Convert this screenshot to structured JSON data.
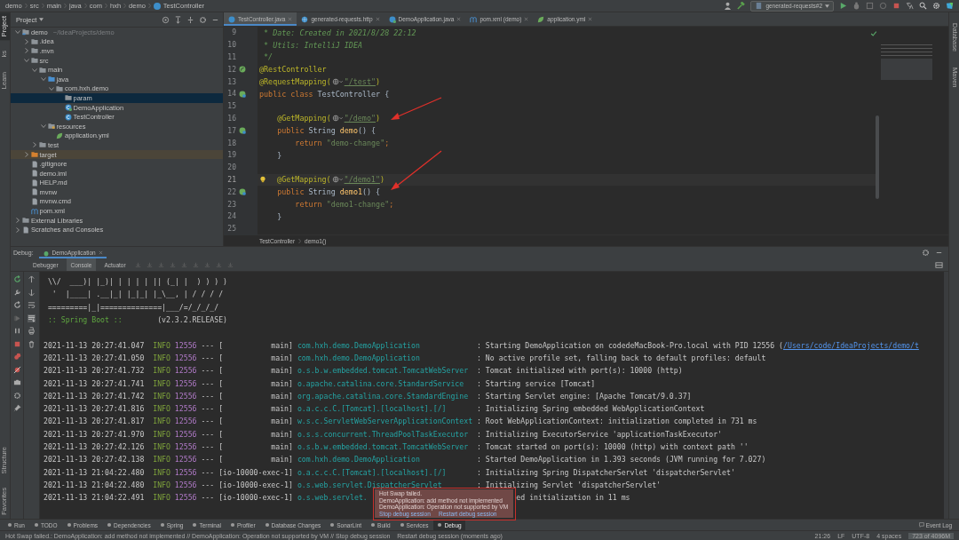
{
  "breadcrumb": [
    "demo",
    "src",
    "main",
    "java",
    "com",
    "hxh",
    "demo",
    "TestController"
  ],
  "run_config": "generated-requests#2",
  "left_strip": {
    "top": [
      {
        "label": "Project",
        "selected": true
      },
      {
        "label": "ks",
        "selected": false
      },
      {
        "label": "Learn",
        "selected": false
      }
    ],
    "bottom": [
      {
        "label": "Structure",
        "selected": false
      },
      {
        "label": "Favorites",
        "selected": false
      }
    ]
  },
  "right_strip": [
    "Database",
    "Maven"
  ],
  "project_panel": {
    "title": "Project",
    "tree": [
      {
        "label": "demo",
        "hint": "~/IdeaProjects/demo",
        "kind": "module",
        "expanded": true,
        "selected": false,
        "children": [
          {
            "label": ".idea",
            "kind": "folder",
            "expanded": false,
            "selected": false
          },
          {
            "label": ".mvn",
            "kind": "folder",
            "expanded": false,
            "selected": false
          },
          {
            "label": "src",
            "kind": "folder",
            "expanded": true,
            "selected": false,
            "children": [
              {
                "label": "main",
                "kind": "folder",
                "expanded": true,
                "selected": false,
                "children": [
                  {
                    "label": "java",
                    "kind": "source-folder",
                    "expanded": true,
                    "selected": false,
                    "children": [
                      {
                        "label": "com.hxh.demo",
                        "kind": "package",
                        "expanded": true,
                        "selected": false,
                        "children": [
                          {
                            "label": "param",
                            "kind": "package",
                            "selected": true
                          },
                          {
                            "label": "DemoApplication",
                            "kind": "app-class",
                            "selected": false
                          },
                          {
                            "label": "TestController",
                            "kind": "class",
                            "selected": false
                          }
                        ]
                      }
                    ]
                  },
                  {
                    "label": "resources",
                    "kind": "resource-folder",
                    "expanded": true,
                    "selected": false,
                    "children": [
                      {
                        "label": "application.yml",
                        "kind": "yml",
                        "selected": false
                      }
                    ]
                  }
                ]
              },
              {
                "label": "test",
                "kind": "folder",
                "expanded": false,
                "selected": false
              }
            ]
          },
          {
            "label": "target",
            "kind": "excluded-folder",
            "expanded": false,
            "selected": false
          },
          {
            "label": ".gitignore",
            "kind": "file",
            "selected": false
          },
          {
            "label": "demo.iml",
            "kind": "file",
            "selected": false
          },
          {
            "label": "HELP.md",
            "kind": "file",
            "selected": false
          },
          {
            "label": "mvnw",
            "kind": "file",
            "selected": false
          },
          {
            "label": "mvnw.cmd",
            "kind": "file",
            "selected": false
          },
          {
            "label": "pom.xml",
            "kind": "maven",
            "selected": false
          }
        ]
      },
      {
        "label": "External Libraries",
        "kind": "library",
        "expanded": false,
        "selected": false
      },
      {
        "label": "Scratches and Consoles",
        "kind": "scratches",
        "expanded": false,
        "selected": false
      }
    ]
  },
  "editor": {
    "tabs": [
      {
        "label": "TestController.java",
        "kind": "class",
        "selected": true
      },
      {
        "label": "generated-requests.http",
        "kind": "http",
        "selected": false
      },
      {
        "label": "DemoApplication.java",
        "kind": "app-class",
        "selected": false
      },
      {
        "label": "pom.xml (demo)",
        "kind": "maven",
        "selected": false
      },
      {
        "label": "application.yml",
        "kind": "yml",
        "selected": false
      }
    ],
    "lines": [
      {
        "number": "9",
        "current": false,
        "kind": "plain",
        "tokens": [
          {
            "kind": "comment",
            "text": " * Date: Created in 2021/8/28 22:12"
          }
        ]
      },
      {
        "number": "10",
        "current": false,
        "kind": "plain",
        "tokens": [
          {
            "kind": "comment",
            "text": " * Utils: IntelliJ IDEA"
          }
        ]
      },
      {
        "number": "11",
        "current": false,
        "kind": "plain",
        "tokens": [
          {
            "kind": "comment",
            "text": " */"
          }
        ]
      },
      {
        "number": "12",
        "current": false,
        "kind": "bean",
        "tokens": [
          {
            "kind": "annotation",
            "text": "@RestController"
          }
        ]
      },
      {
        "number": "13",
        "current": false,
        "kind": "plain",
        "tokens": [
          {
            "kind": "annotation",
            "text": "@RequestMapping("
          },
          {
            "kind": "globe"
          },
          {
            "kind": "url",
            "text": "\"/test\""
          },
          {
            "kind": "annotation",
            "text": ")"
          }
        ]
      },
      {
        "number": "14",
        "current": false,
        "kind": "web-bean",
        "tokens": [
          {
            "kind": "keyword",
            "text": "public class "
          },
          {
            "kind": "plain",
            "text": "TestController {"
          }
        ]
      },
      {
        "number": "15",
        "current": false,
        "kind": "plain"
      },
      {
        "number": "16",
        "current": false,
        "kind": "plain",
        "tokens": [
          {
            "kind": "annotation",
            "text": "    @GetMapping("
          },
          {
            "kind": "globe"
          },
          {
            "kind": "url",
            "text": "\"/demo\""
          },
          {
            "kind": "annotation",
            "text": ")"
          }
        ]
      },
      {
        "number": "17",
        "current": false,
        "kind": "web-bean",
        "tokens": [
          {
            "kind": "keyword",
            "text": "    public "
          },
          {
            "kind": "plain",
            "text": "String "
          },
          {
            "kind": "method",
            "text": "demo"
          },
          {
            "kind": "plain",
            "text": "() {"
          }
        ]
      },
      {
        "number": "18",
        "current": false,
        "kind": "plain",
        "tokens": [
          {
            "kind": "keyword",
            "text": "        return "
          },
          {
            "kind": "string",
            "text": "\"demo-change\""
          },
          {
            "kind": "keyword",
            "text": ";"
          }
        ]
      },
      {
        "number": "19",
        "current": false,
        "kind": "plain",
        "tokens": [
          {
            "kind": "plain",
            "text": "    }"
          }
        ]
      },
      {
        "number": "20",
        "current": false,
        "kind": "plain"
      },
      {
        "number": "21",
        "current": true,
        "kind": "plain",
        "tokens": [
          {
            "kind": "bulb"
          },
          {
            "kind": "annotation",
            "text": "  @GetMapping("
          },
          {
            "kind": "globe"
          },
          {
            "kind": "url",
            "text": "\"/demo1\""
          },
          {
            "kind": "annotation",
            "text": ")"
          }
        ]
      },
      {
        "number": "22",
        "current": false,
        "kind": "web-bean",
        "tokens": [
          {
            "kind": "keyword",
            "text": "    public "
          },
          {
            "kind": "plain",
            "text": "String "
          },
          {
            "kind": "method",
            "text": "demo1"
          },
          {
            "kind": "plain",
            "text": "() {"
          }
        ]
      },
      {
        "number": "23",
        "current": false,
        "kind": "plain",
        "tokens": [
          {
            "kind": "keyword",
            "text": "        return "
          },
          {
            "kind": "string",
            "text": "\"demo1-change\""
          },
          {
            "kind": "keyword",
            "text": ";"
          }
        ]
      },
      {
        "number": "24",
        "current": false,
        "kind": "plain",
        "tokens": [
          {
            "kind": "plain",
            "text": "    }"
          }
        ]
      },
      {
        "number": "25",
        "current": false,
        "kind": "plain"
      }
    ],
    "breadcrumb": [
      "TestController",
      "demo1()"
    ]
  },
  "debug": {
    "label": "Debug:",
    "session": "DemoApplication",
    "tabs": [
      {
        "label": "Debugger",
        "selected": false
      },
      {
        "label": "Console",
        "selected": true
      },
      {
        "label": "Actuator",
        "selected": false
      }
    ],
    "banner": [
      [
        {
          "kind": "art",
          "text": " \\\\/  ___)| |_)| | | | | || (_| |  ) ) ) )"
        }
      ],
      [
        {
          "kind": "art",
          "text": "  '  |____| .__|_| |_|_| |_\\__, | / / / /"
        }
      ],
      [
        {
          "kind": "art",
          "text": " =========|_|==============|___/=/_/_/_/"
        }
      ],
      [
        {
          "kind": "label",
          "text": " :: Spring Boot ::"
        },
        {
          "kind": "version",
          "text": "(v2.3.2.RELEASE)"
        }
      ]
    ],
    "log": [
      {
        "time": "2021-11-13 20:27:41.047",
        "level": "INFO",
        "pid": "12556",
        "sep": "---",
        "thread": "[           main]",
        "logger": "com.hxh.demo.DemoApplication",
        "kind": "full",
        "message": ": Starting DemoApplication on codedeMacBook-Pro.local with PID 12556 (",
        "link": "/Users/code/IdeaProjects/demo/t"
      },
      {
        "time": "2021-11-13 20:27:41.050",
        "level": "INFO",
        "pid": "12556",
        "sep": "---",
        "thread": "[           main]",
        "logger": "com.hxh.demo.DemoApplication",
        "kind": "full",
        "message": ": No active profile set, falling back to default profiles: default"
      },
      {
        "time": "2021-11-13 20:27:41.732",
        "level": "INFO",
        "pid": "12556",
        "sep": "---",
        "thread": "[           main]",
        "logger": "o.s.b.w.embedded.tomcat.TomcatWebServer",
        "kind": "full",
        "message": ": Tomcat initialized with port(s): 10000 (http)"
      },
      {
        "time": "2021-11-13 20:27:41.741",
        "level": "INFO",
        "pid": "12556",
        "sep": "---",
        "thread": "[           main]",
        "logger": "o.apache.catalina.core.StandardService",
        "kind": "full",
        "message": ": Starting service [Tomcat]"
      },
      {
        "time": "2021-11-13 20:27:41.742",
        "level": "INFO",
        "pid": "12556",
        "sep": "---",
        "thread": "[           main]",
        "logger": "org.apache.catalina.core.StandardEngine",
        "kind": "full",
        "message": ": Starting Servlet engine: [Apache Tomcat/9.0.37]"
      },
      {
        "time": "2021-11-13 20:27:41.816",
        "level": "INFO",
        "pid": "12556",
        "sep": "---",
        "thread": "[           main]",
        "logger": "o.a.c.c.C.[Tomcat].[localhost].[/]",
        "kind": "full",
        "message": ": Initializing Spring embedded WebApplicationContext"
      },
      {
        "time": "2021-11-13 20:27:41.817",
        "level": "INFO",
        "pid": "12556",
        "sep": "---",
        "thread": "[           main]",
        "logger": "w.s.c.ServletWebServerApplicationContext",
        "kind": "full",
        "message": ": Root WebApplicationContext: initialization completed in 731 ms"
      },
      {
        "time": "2021-11-13 20:27:41.970",
        "level": "INFO",
        "pid": "12556",
        "sep": "---",
        "thread": "[           main]",
        "logger": "o.s.s.concurrent.ThreadPoolTaskExecutor",
        "kind": "full",
        "message": ": Initializing ExecutorService 'applicationTaskExecutor'"
      },
      {
        "time": "2021-11-13 20:27:42.126",
        "level": "INFO",
        "pid": "12556",
        "sep": "---",
        "thread": "[           main]",
        "logger": "o.s.b.w.embedded.tomcat.TomcatWebServer",
        "kind": "full",
        "message": ": Tomcat started on port(s): 10000 (http) with context path ''"
      },
      {
        "time": "2021-11-13 20:27:42.138",
        "level": "INFO",
        "pid": "12556",
        "sep": "---",
        "thread": "[           main]",
        "logger": "com.hxh.demo.DemoApplication",
        "kind": "full",
        "message": ": Started DemoApplication in 1.393 seconds (JVM running for 7.027)"
      },
      {
        "time": "2021-11-13 21:04:22.480",
        "level": "INFO",
        "pid": "12556",
        "sep": "---",
        "thread": "[io-10000-exec-1]",
        "logger": "o.a.c.c.C.[Tomcat].[localhost].[/]",
        "kind": "full",
        "message": ": Initializing Spring DispatcherServlet 'dispatcherServlet'"
      },
      {
        "time": "2021-11-13 21:04:22.480",
        "level": "INFO",
        "pid": "12556",
        "sep": "---",
        "thread": "[io-10000-exec-1]",
        "logger": "o.s.web.servlet.DispatcherServlet",
        "kind": "full",
        "message": ": Initializing Servlet 'dispatcherServlet'"
      },
      {
        "time": "2021-11-13 21:04:22.491",
        "level": "INFO",
        "pid": "12556",
        "sep": "---",
        "thread": "[io-10000-exec-1]",
        "logger": "o.s.web.servlet.",
        "kind": "covered",
        "message": "ed initialization in 11 ms"
      }
    ]
  },
  "popup": {
    "title": "Hot Swap failed.",
    "messages": [
      "DemoApplication: add method not implemented",
      "DemoApplication: Operation not supported by VM"
    ],
    "actions": [
      "Stop debug session",
      "Restart debug session"
    ]
  },
  "tool_windows": [
    {
      "label": "Run",
      "selected": false
    },
    {
      "label": "TODO",
      "selected": false
    },
    {
      "label": "Problems",
      "selected": false
    },
    {
      "label": "Dependencies",
      "selected": false
    },
    {
      "label": "Spring",
      "selected": false
    },
    {
      "label": "Terminal",
      "selected": false
    },
    {
      "label": "Profiler",
      "selected": false
    },
    {
      "label": "Database Changes",
      "selected": false
    },
    {
      "label": "SonarLint",
      "selected": false
    },
    {
      "label": "Build",
      "selected": false
    },
    {
      "label": "Services",
      "selected": false
    },
    {
      "label": "Debug",
      "selected": true
    }
  ],
  "event_log": "Event Log",
  "status_bar": {
    "message": "Hot Swap failed.: DemoApplication: add method not implemented // DemoApplication: Operation not supported by VM // Stop debug session    Restart debug session (moments ago)",
    "items": [
      "21:26",
      "LF",
      "UTF-8",
      "4 spaces"
    ],
    "memory": "723 of 4096M"
  }
}
